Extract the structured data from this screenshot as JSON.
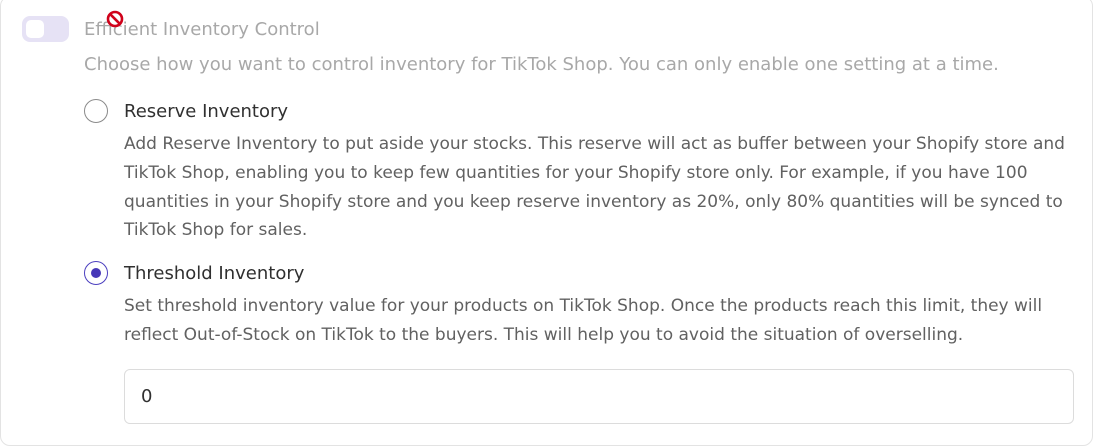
{
  "section": {
    "title": "Efficient Inventory Control",
    "subtitle": "Choose how you want to control inventory for TikTok Shop. You can only enable one setting at a time.",
    "toggle_enabled": false
  },
  "options": [
    {
      "label": "Reserve Inventory",
      "description": "Add Reserve Inventory to put aside your stocks. This reserve will act as buffer between your Shopify store and TikTok Shop, enabling you to keep few quantities for your Shopify store only. For example, if you have 100 quantities in your Shopify store and you keep reserve inventory as 20%, only 80% quantities will be synced to TikTok Shop for sales.",
      "selected": false
    },
    {
      "label": "Threshold Inventory",
      "description": "Set threshold inventory value for your products on TikTok Shop. Once the products reach this limit, they will reflect Out-of-Stock on TikTok to the buyers. This will help you to avoid the situation of overselling.",
      "selected": true
    }
  ],
  "threshold_input": {
    "value": "0"
  },
  "icons": {
    "cursor": "not-allowed-icon"
  },
  "colors": {
    "accent": "#4637b8",
    "toggle_track": "#e6e2f5",
    "cursor_red": "#d0021b"
  }
}
